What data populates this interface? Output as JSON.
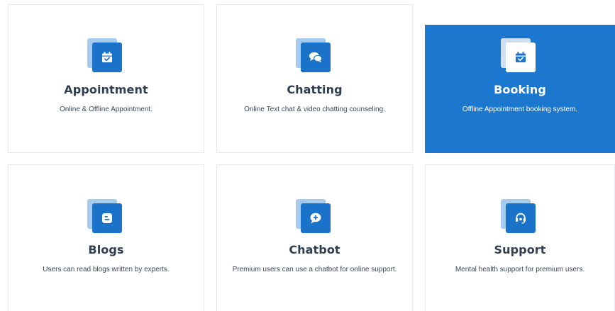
{
  "services": [
    {
      "title": "Appointment",
      "description": "Online & Offline Appointment.",
      "icon": "calendar-check-icon",
      "active": false
    },
    {
      "title": "Chatting",
      "description": "Online Text chat & video chatting counseling.",
      "icon": "chat-bubbles-icon",
      "active": false
    },
    {
      "title": "Booking",
      "description": "Offline Appointment booking system.",
      "icon": "calendar-check-icon",
      "active": true
    },
    {
      "title": "Blogs",
      "description": "Users can read blogs written by experts.",
      "icon": "blogger-icon",
      "active": false
    },
    {
      "title": "Chatbot",
      "description": "Premium users can use a chatbot for online support.",
      "icon": "chat-plus-icon",
      "active": false
    },
    {
      "title": "Support",
      "description": "Mental health support for premium users.",
      "icon": "headset-icon",
      "active": false
    }
  ],
  "colors": {
    "accent": "#1c78cf",
    "icon_front": "#1a73c9",
    "icon_back": "#a7cbef",
    "title": "#2f3e55",
    "text": "#3c4858"
  }
}
